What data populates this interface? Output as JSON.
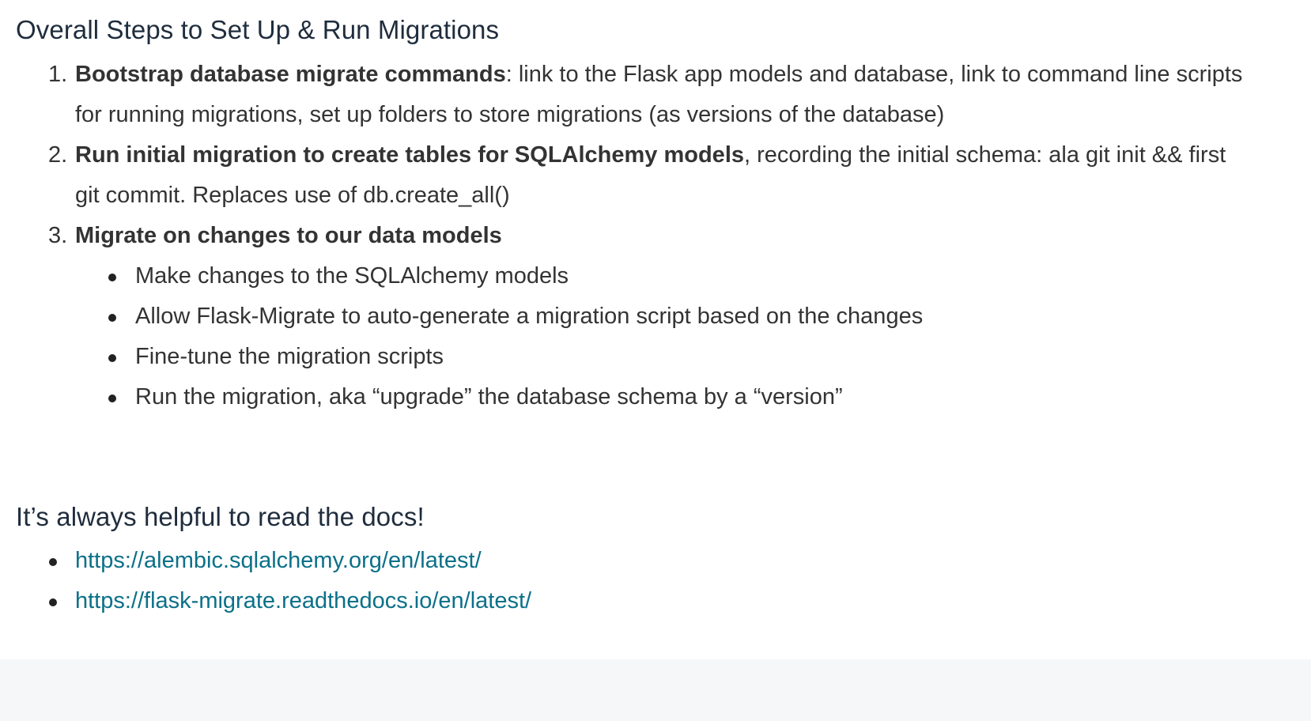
{
  "section1": {
    "heading": "Overall Steps to Set Up & Run Migrations",
    "steps": [
      {
        "number": "1.",
        "bold": "Bootstrap database migrate commands",
        "text": ": link to the Flask app models and database, link to command line scripts for running migrations, set up folders to store migrations (as versions of the database)"
      },
      {
        "number": "2.",
        "bold": "Run initial migration to create tables for SQLAlchemy models",
        "text": ", recording the initial schema: ala git init && first git commit. Replaces use of db.create_all()"
      },
      {
        "number": "3.",
        "bold": "Migrate on changes to our data models",
        "text": "",
        "subitems": [
          "Make changes to the SQLAlchemy models",
          "Allow Flask-Migrate to auto-generate a migration script based on the changes",
          "Fine-tune the migration scripts",
          "Run the migration, aka “upgrade” the database schema by a “version”"
        ]
      }
    ]
  },
  "section2": {
    "heading": "It’s always helpful to read the docs!",
    "links": [
      "https://alembic.sqlalchemy.org/en/latest/",
      "https://flask-migrate.readthedocs.io/en/latest/"
    ]
  },
  "colors": {
    "heading": "#1f2d3d",
    "body_text": "#333333",
    "link": "#0b7089",
    "footer_background": "#f6f7f9"
  }
}
